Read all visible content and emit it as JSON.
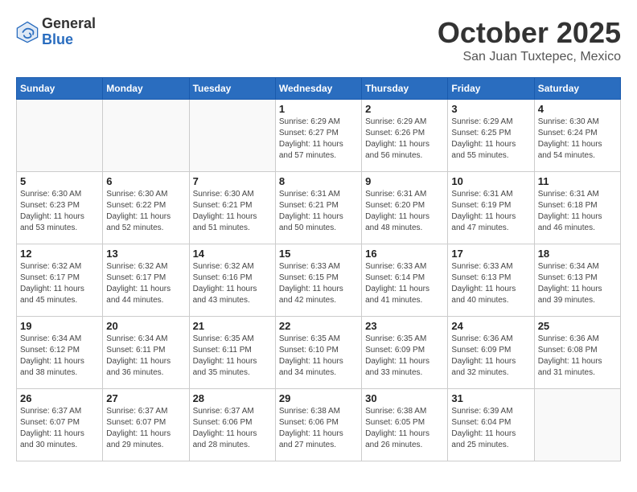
{
  "header": {
    "logo_general": "General",
    "logo_blue": "Blue",
    "month_title": "October 2025",
    "location": "San Juan Tuxtepec, Mexico"
  },
  "days_of_week": [
    "Sunday",
    "Monday",
    "Tuesday",
    "Wednesday",
    "Thursday",
    "Friday",
    "Saturday"
  ],
  "weeks": [
    [
      {
        "day": "",
        "info": ""
      },
      {
        "day": "",
        "info": ""
      },
      {
        "day": "",
        "info": ""
      },
      {
        "day": "1",
        "info": "Sunrise: 6:29 AM\nSunset: 6:27 PM\nDaylight: 11 hours\nand 57 minutes."
      },
      {
        "day": "2",
        "info": "Sunrise: 6:29 AM\nSunset: 6:26 PM\nDaylight: 11 hours\nand 56 minutes."
      },
      {
        "day": "3",
        "info": "Sunrise: 6:29 AM\nSunset: 6:25 PM\nDaylight: 11 hours\nand 55 minutes."
      },
      {
        "day": "4",
        "info": "Sunrise: 6:30 AM\nSunset: 6:24 PM\nDaylight: 11 hours\nand 54 minutes."
      }
    ],
    [
      {
        "day": "5",
        "info": "Sunrise: 6:30 AM\nSunset: 6:23 PM\nDaylight: 11 hours\nand 53 minutes."
      },
      {
        "day": "6",
        "info": "Sunrise: 6:30 AM\nSunset: 6:22 PM\nDaylight: 11 hours\nand 52 minutes."
      },
      {
        "day": "7",
        "info": "Sunrise: 6:30 AM\nSunset: 6:21 PM\nDaylight: 11 hours\nand 51 minutes."
      },
      {
        "day": "8",
        "info": "Sunrise: 6:31 AM\nSunset: 6:21 PM\nDaylight: 11 hours\nand 50 minutes."
      },
      {
        "day": "9",
        "info": "Sunrise: 6:31 AM\nSunset: 6:20 PM\nDaylight: 11 hours\nand 48 minutes."
      },
      {
        "day": "10",
        "info": "Sunrise: 6:31 AM\nSunset: 6:19 PM\nDaylight: 11 hours\nand 47 minutes."
      },
      {
        "day": "11",
        "info": "Sunrise: 6:31 AM\nSunset: 6:18 PM\nDaylight: 11 hours\nand 46 minutes."
      }
    ],
    [
      {
        "day": "12",
        "info": "Sunrise: 6:32 AM\nSunset: 6:17 PM\nDaylight: 11 hours\nand 45 minutes."
      },
      {
        "day": "13",
        "info": "Sunrise: 6:32 AM\nSunset: 6:17 PM\nDaylight: 11 hours\nand 44 minutes."
      },
      {
        "day": "14",
        "info": "Sunrise: 6:32 AM\nSunset: 6:16 PM\nDaylight: 11 hours\nand 43 minutes."
      },
      {
        "day": "15",
        "info": "Sunrise: 6:33 AM\nSunset: 6:15 PM\nDaylight: 11 hours\nand 42 minutes."
      },
      {
        "day": "16",
        "info": "Sunrise: 6:33 AM\nSunset: 6:14 PM\nDaylight: 11 hours\nand 41 minutes."
      },
      {
        "day": "17",
        "info": "Sunrise: 6:33 AM\nSunset: 6:13 PM\nDaylight: 11 hours\nand 40 minutes."
      },
      {
        "day": "18",
        "info": "Sunrise: 6:34 AM\nSunset: 6:13 PM\nDaylight: 11 hours\nand 39 minutes."
      }
    ],
    [
      {
        "day": "19",
        "info": "Sunrise: 6:34 AM\nSunset: 6:12 PM\nDaylight: 11 hours\nand 38 minutes."
      },
      {
        "day": "20",
        "info": "Sunrise: 6:34 AM\nSunset: 6:11 PM\nDaylight: 11 hours\nand 36 minutes."
      },
      {
        "day": "21",
        "info": "Sunrise: 6:35 AM\nSunset: 6:11 PM\nDaylight: 11 hours\nand 35 minutes."
      },
      {
        "day": "22",
        "info": "Sunrise: 6:35 AM\nSunset: 6:10 PM\nDaylight: 11 hours\nand 34 minutes."
      },
      {
        "day": "23",
        "info": "Sunrise: 6:35 AM\nSunset: 6:09 PM\nDaylight: 11 hours\nand 33 minutes."
      },
      {
        "day": "24",
        "info": "Sunrise: 6:36 AM\nSunset: 6:09 PM\nDaylight: 11 hours\nand 32 minutes."
      },
      {
        "day": "25",
        "info": "Sunrise: 6:36 AM\nSunset: 6:08 PM\nDaylight: 11 hours\nand 31 minutes."
      }
    ],
    [
      {
        "day": "26",
        "info": "Sunrise: 6:37 AM\nSunset: 6:07 PM\nDaylight: 11 hours\nand 30 minutes."
      },
      {
        "day": "27",
        "info": "Sunrise: 6:37 AM\nSunset: 6:07 PM\nDaylight: 11 hours\nand 29 minutes."
      },
      {
        "day": "28",
        "info": "Sunrise: 6:37 AM\nSunset: 6:06 PM\nDaylight: 11 hours\nand 28 minutes."
      },
      {
        "day": "29",
        "info": "Sunrise: 6:38 AM\nSunset: 6:06 PM\nDaylight: 11 hours\nand 27 minutes."
      },
      {
        "day": "30",
        "info": "Sunrise: 6:38 AM\nSunset: 6:05 PM\nDaylight: 11 hours\nand 26 minutes."
      },
      {
        "day": "31",
        "info": "Sunrise: 6:39 AM\nSunset: 6:04 PM\nDaylight: 11 hours\nand 25 minutes."
      },
      {
        "day": "",
        "info": ""
      }
    ]
  ]
}
